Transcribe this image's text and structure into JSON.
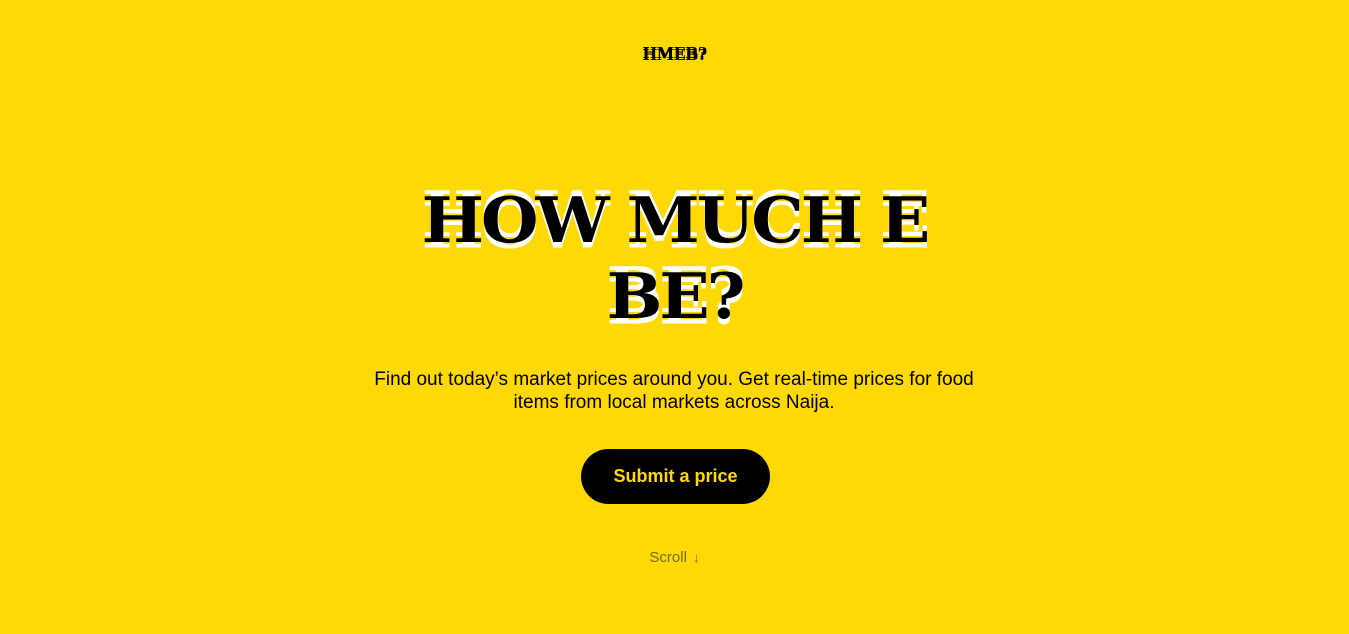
{
  "brand": {
    "logo_text": "HMEB?",
    "background_color": "#FFD905",
    "accent_color": "#000000",
    "button_text_color": "#FFD905"
  },
  "hero": {
    "headline_line1": "HOW MUCH E",
    "headline_line2": "BE?",
    "subtitle": "Find out today’s market prices around you. Get real-time prices for food items from local markets across Naija.",
    "cta_label": "Submit a price"
  },
  "footer_hint": {
    "scroll_label": "Scroll",
    "arrow_icon": "arrow-down-icon",
    "arrow_glyph": "↓"
  }
}
